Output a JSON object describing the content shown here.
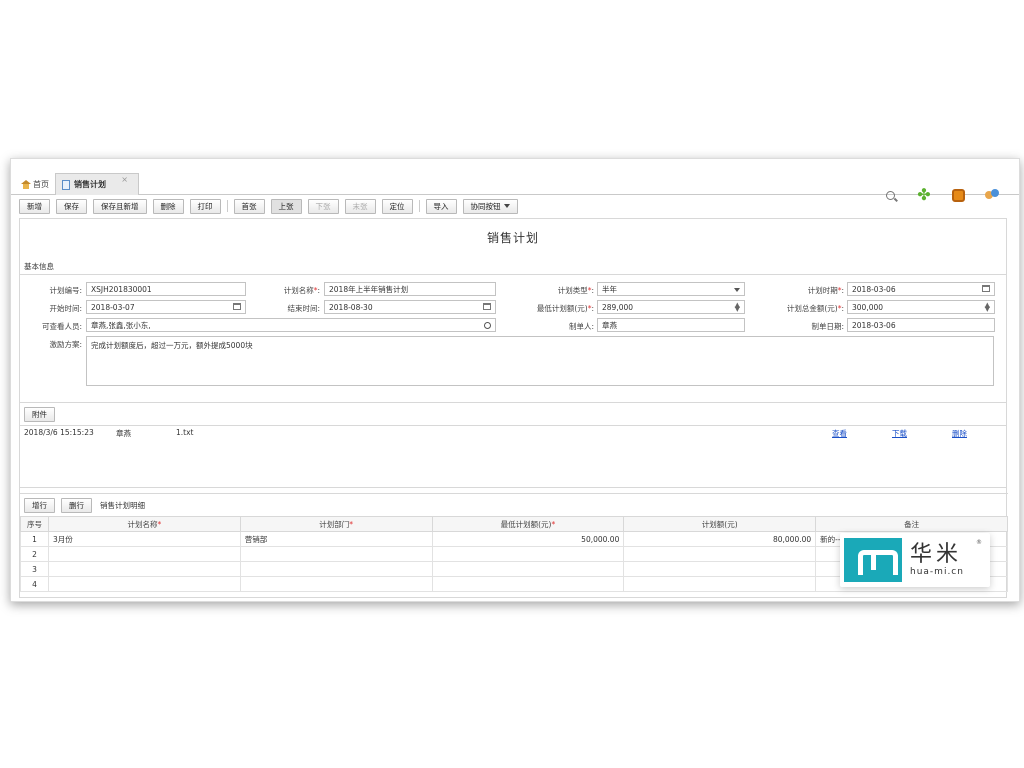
{
  "tabs": {
    "home_label": "首页",
    "active_label": "销售计划",
    "close_glyph": "×"
  },
  "header_icons": [
    "search-icon",
    "flower-icon",
    "bag-icon",
    "users-icon"
  ],
  "toolbar": {
    "new": "新增",
    "save": "保存",
    "save_new": "保存且新增",
    "delete": "删除",
    "print": "打印",
    "first": "首张",
    "prev": "上张",
    "next": "下张",
    "last": "末张",
    "locate": "定位",
    "import": "导入",
    "collab": "协同按钮"
  },
  "form": {
    "title": "销售计划",
    "section": "基本信息",
    "plan_no": {
      "label": "计划编号:",
      "value": "XSJH201830001"
    },
    "plan_name": {
      "label": "计划名称",
      "required": "*",
      "colon": ":",
      "value": "2018年上半年销售计划"
    },
    "plan_type": {
      "label": "计划类型",
      "required": "*",
      "colon": ":",
      "value": "半年"
    },
    "plan_period": {
      "label": "计划时期",
      "required": "*",
      "colon": ":",
      "value": "2018-03-06"
    },
    "start_time": {
      "label": "开始时间:",
      "value": "2018-03-07"
    },
    "end_time": {
      "label": "结束时间:",
      "value": "2018-08-30"
    },
    "min_amount": {
      "label": "最低计划额(元)",
      "required": "*",
      "colon": ":",
      "value": "289,000"
    },
    "total_amount": {
      "label": "计划总金额(元)",
      "required": "*",
      "colon": ":",
      "value": "300,000"
    },
    "viewers": {
      "label": "可查看人员:",
      "value": "章燕,张鑫,张小东,"
    },
    "creator": {
      "label": "制单人:",
      "value": "章燕"
    },
    "create_date": {
      "label": "制单日期:",
      "value": "2018-03-06"
    },
    "incentive": {
      "label": "激励方案:",
      "value": "完成计划额度后，超过一万元，额外提成5000块"
    }
  },
  "attachments": {
    "button": "附件",
    "rows": [
      {
        "time": "2018/3/6 15:15:23",
        "user": "章燕",
        "file": "1.txt",
        "view": "查看",
        "download": "下载",
        "delete": "删除"
      }
    ]
  },
  "detail": {
    "add_row": "增行",
    "delete_row": "删行",
    "title": "销售计划明细",
    "columns": [
      {
        "label": "序号",
        "required": ""
      },
      {
        "label": "计划名称",
        "required": "*"
      },
      {
        "label": "计划部门",
        "required": "*"
      },
      {
        "label": "最低计划额(元)",
        "required": "*"
      },
      {
        "label": "计划额(元)",
        "required": ""
      },
      {
        "label": "备注",
        "required": ""
      }
    ],
    "rows": [
      {
        "no": "1",
        "name": "3月份",
        "dept": "营销部",
        "min": "50,000.00",
        "amount": "80,000.00",
        "note": "新的---"
      },
      {
        "no": "2",
        "name": "",
        "dept": "",
        "min": "",
        "amount": "",
        "note": ""
      },
      {
        "no": "3",
        "name": "",
        "dept": "",
        "min": "",
        "amount": "",
        "note": ""
      },
      {
        "no": "4",
        "name": "",
        "dept": "",
        "min": "",
        "amount": "",
        "note": ""
      }
    ]
  },
  "watermark": {
    "brand_cn": "华米",
    "brand_en": "hua-mi.cn",
    "reg": "®",
    "color": "#1aa9b8"
  }
}
